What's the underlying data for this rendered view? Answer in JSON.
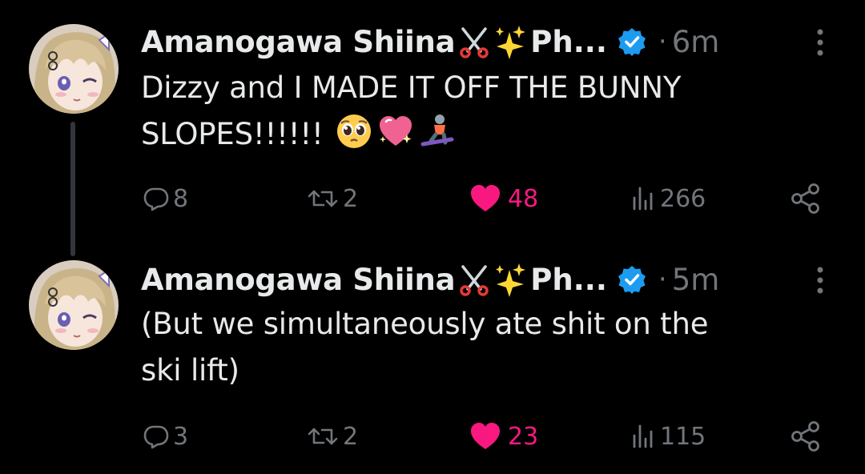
{
  "colors": {
    "background": "#000000",
    "text": "#e7e9ea",
    "muted": "#71767b",
    "like": "#f91880",
    "verified": "#1d9bf0",
    "thread_line": "#333639"
  },
  "tweets": [
    {
      "author": {
        "name": "Amanogawa Shiina",
        "name_emojis": [
          "scissors-emoji",
          "sparkles-emoji"
        ],
        "name_tail": "Ph...",
        "verified": true
      },
      "separator": "·",
      "time": "6m",
      "text_lines": [
        "Dizzy and I MADE IT OFF THE BUNNY",
        "SLOPES!!!!!!"
      ],
      "text_emojis": [
        "pleading-face-emoji",
        "sparkling-heart-emoji",
        "snowboarder-emoji"
      ],
      "stats": {
        "replies": "8",
        "retweets": "2",
        "likes": "48",
        "views": "266"
      },
      "liked": true
    },
    {
      "author": {
        "name": "Amanogawa Shiina",
        "name_emojis": [
          "scissors-emoji",
          "sparkles-emoji"
        ],
        "name_tail": "Ph...",
        "verified": true
      },
      "separator": "·",
      "time": "5m",
      "text_lines": [
        "(But we simultaneously ate shit on the",
        "ski lift)"
      ],
      "text_emojis": [],
      "stats": {
        "replies": "3",
        "retweets": "2",
        "likes": "23",
        "views": "115"
      },
      "liked": true
    }
  ]
}
